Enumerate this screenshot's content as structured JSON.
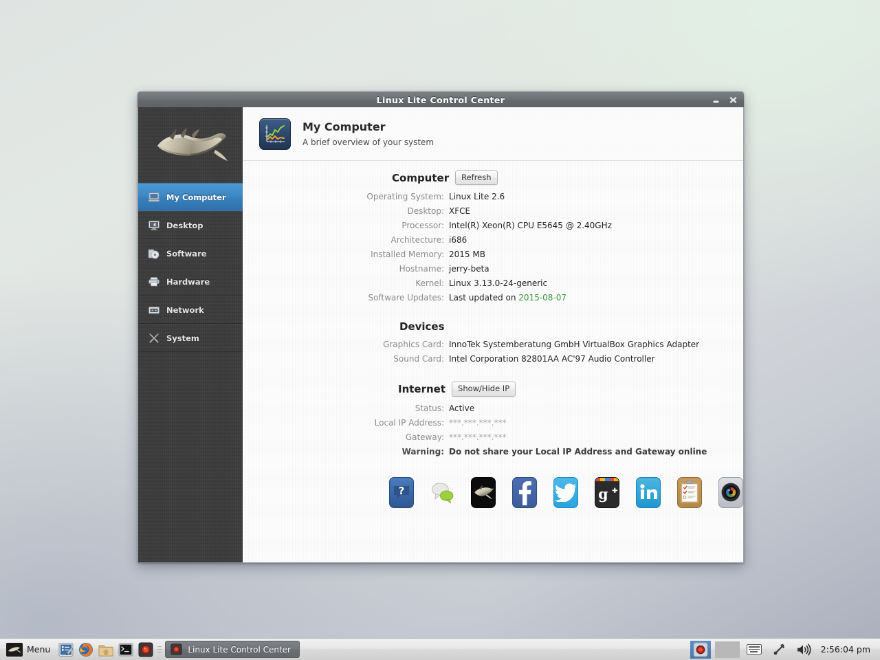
{
  "window": {
    "title": "Linux Lite Control Center",
    "minimize_label": "minimize",
    "close_label": "close"
  },
  "sidebar": {
    "logo_name": "linux-lite-feather-logo",
    "items": [
      {
        "label": "My Computer",
        "icon": "laptop-icon",
        "active": true
      },
      {
        "label": "Desktop",
        "icon": "monitor-icon",
        "active": false
      },
      {
        "label": "Software",
        "icon": "disc-icon",
        "active": false
      },
      {
        "label": "Hardware",
        "icon": "printer-icon",
        "active": false
      },
      {
        "label": "Network",
        "icon": "modem-icon",
        "active": false
      },
      {
        "label": "System",
        "icon": "tools-icon",
        "active": false
      }
    ]
  },
  "header": {
    "icon": "line-chart-icon",
    "title": "My Computer",
    "subtitle": "A brief overview of your system"
  },
  "computer": {
    "section_title": "Computer",
    "refresh_label": "Refresh",
    "rows": [
      {
        "key": "Operating System:",
        "value": "Linux Lite 2.6"
      },
      {
        "key": "Desktop:",
        "value": "XFCE"
      },
      {
        "key": "Processor:",
        "value": "Intel(R) Xeon(R) CPU E5645 @ 2.40GHz"
      },
      {
        "key": "Architecture:",
        "value": "i686"
      },
      {
        "key": "Installed Memory:",
        "value": "2015 MB"
      },
      {
        "key": "Hostname:",
        "value": "jerry-beta"
      },
      {
        "key": "Kernel:",
        "value": "Linux 3.13.0-24-generic"
      }
    ],
    "updates_key": "Software Updates:",
    "updates_prefix": "Last updated on ",
    "updates_date": "2015-08-07"
  },
  "devices": {
    "section_title": "Devices",
    "rows": [
      {
        "key": "Graphics Card:",
        "value": "InnoTek Systemberatung GmbH VirtualBox Graphics Adapter"
      },
      {
        "key": "Sound Card:",
        "value": "Intel Corporation 82801AA AC'97 Audio Controller"
      }
    ]
  },
  "internet": {
    "section_title": "Internet",
    "toggle_label": "Show/Hide IP",
    "status_key": "Status:",
    "status_value": "Active",
    "local_ip_key": "Local IP Address:",
    "local_ip_value": "***.***.***.***",
    "gateway_key": "Gateway:",
    "gateway_value": "***.***.***.***",
    "warning_key": "Warning:",
    "warning_value": "Do not share your Local IP Address and Gateway online"
  },
  "social_links": [
    {
      "name": "help-icon",
      "title": "Help"
    },
    {
      "name": "chat-bubbles-icon",
      "title": "Chat"
    },
    {
      "name": "forum-feather-icon",
      "title": "Forums"
    },
    {
      "name": "facebook-icon",
      "title": "Facebook"
    },
    {
      "name": "twitter-icon",
      "title": "Twitter"
    },
    {
      "name": "google-plus-icon",
      "title": "Google Plus"
    },
    {
      "name": "linkedin-icon",
      "title": "LinkedIn"
    },
    {
      "name": "survey-clipboard-icon",
      "title": "Survey"
    },
    {
      "name": "camera-icon",
      "title": "Screenshot"
    }
  ],
  "taskbar": {
    "menu_label": "Menu",
    "launchers": [
      {
        "name": "text-editor-icon"
      },
      {
        "name": "firefox-icon"
      },
      {
        "name": "file-manager-icon"
      },
      {
        "name": "terminal-icon"
      },
      {
        "name": "control-center-icon"
      }
    ],
    "task_button_label": "Linux Lite Control Center",
    "tray": [
      {
        "name": "control-center-tray-icon"
      },
      {
        "name": "keyboard-layout-icon"
      },
      {
        "name": "bluetooth-icon"
      },
      {
        "name": "volume-icon"
      }
    ],
    "clock": "2:56:04 pm"
  },
  "colors": {
    "accent_blue": "#3a81be",
    "status_green": "#3a9a3a",
    "sidebar_dark": "#3b3b3b"
  }
}
